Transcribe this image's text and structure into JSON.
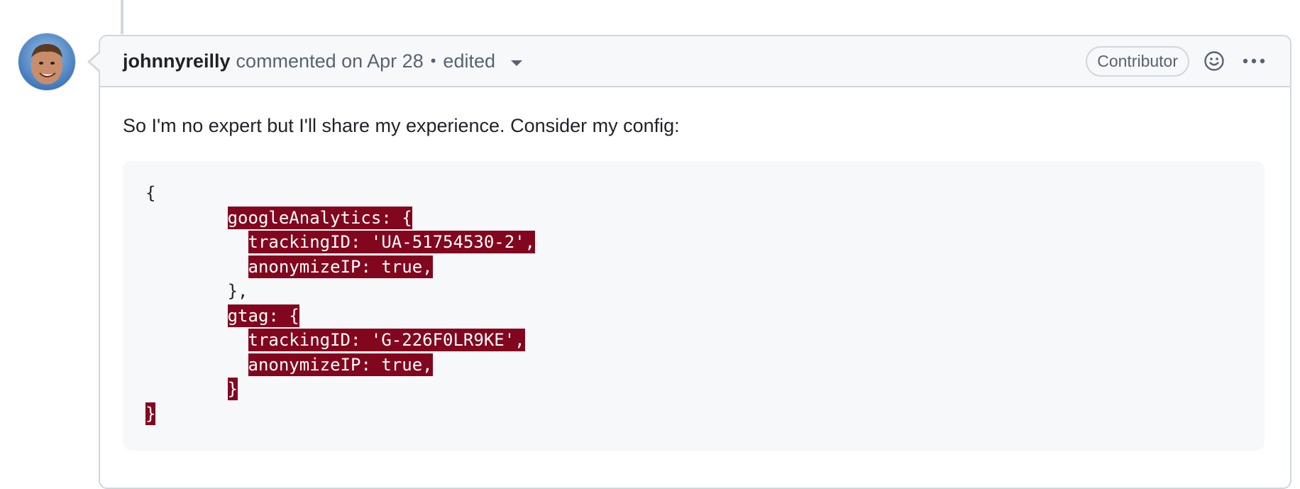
{
  "comment": {
    "author": "johnnyreilly",
    "action": "commented on Apr 28",
    "separator": "•",
    "edited": "edited",
    "badge": "Contributor",
    "body_text": "So I'm no expert but I'll share my experience. Consider my config:",
    "code_lines": [
      {
        "indent": "",
        "text": "{",
        "highlight": false
      },
      {
        "indent": "        ",
        "text": "googleAnalytics: {",
        "highlight": true
      },
      {
        "indent": "          ",
        "text": "trackingID: 'UA-51754530-2',",
        "highlight": true
      },
      {
        "indent": "          ",
        "text": "anonymizeIP: true,",
        "highlight": true
      },
      {
        "indent": "        ",
        "text": "},",
        "highlight": false
      },
      {
        "indent": "        ",
        "text": "gtag: {",
        "highlight": true
      },
      {
        "indent": "          ",
        "text": "trackingID: 'G-226F0LR9KE',",
        "highlight": true
      },
      {
        "indent": "          ",
        "text": "anonymizeIP: true,",
        "highlight": true
      },
      {
        "indent": "        ",
        "text": "}",
        "highlight": true
      },
      {
        "indent": "",
        "text": "}",
        "highlight": true
      }
    ]
  },
  "icons": {
    "reaction": "smiley-icon",
    "more": "kebab-horizontal-icon",
    "dropdown": "triangle-down-icon"
  },
  "colors": {
    "highlight_bg": "#82071e",
    "border": "#d0d7de",
    "header_bg": "#f6f8fa",
    "muted_text": "#59636e"
  }
}
